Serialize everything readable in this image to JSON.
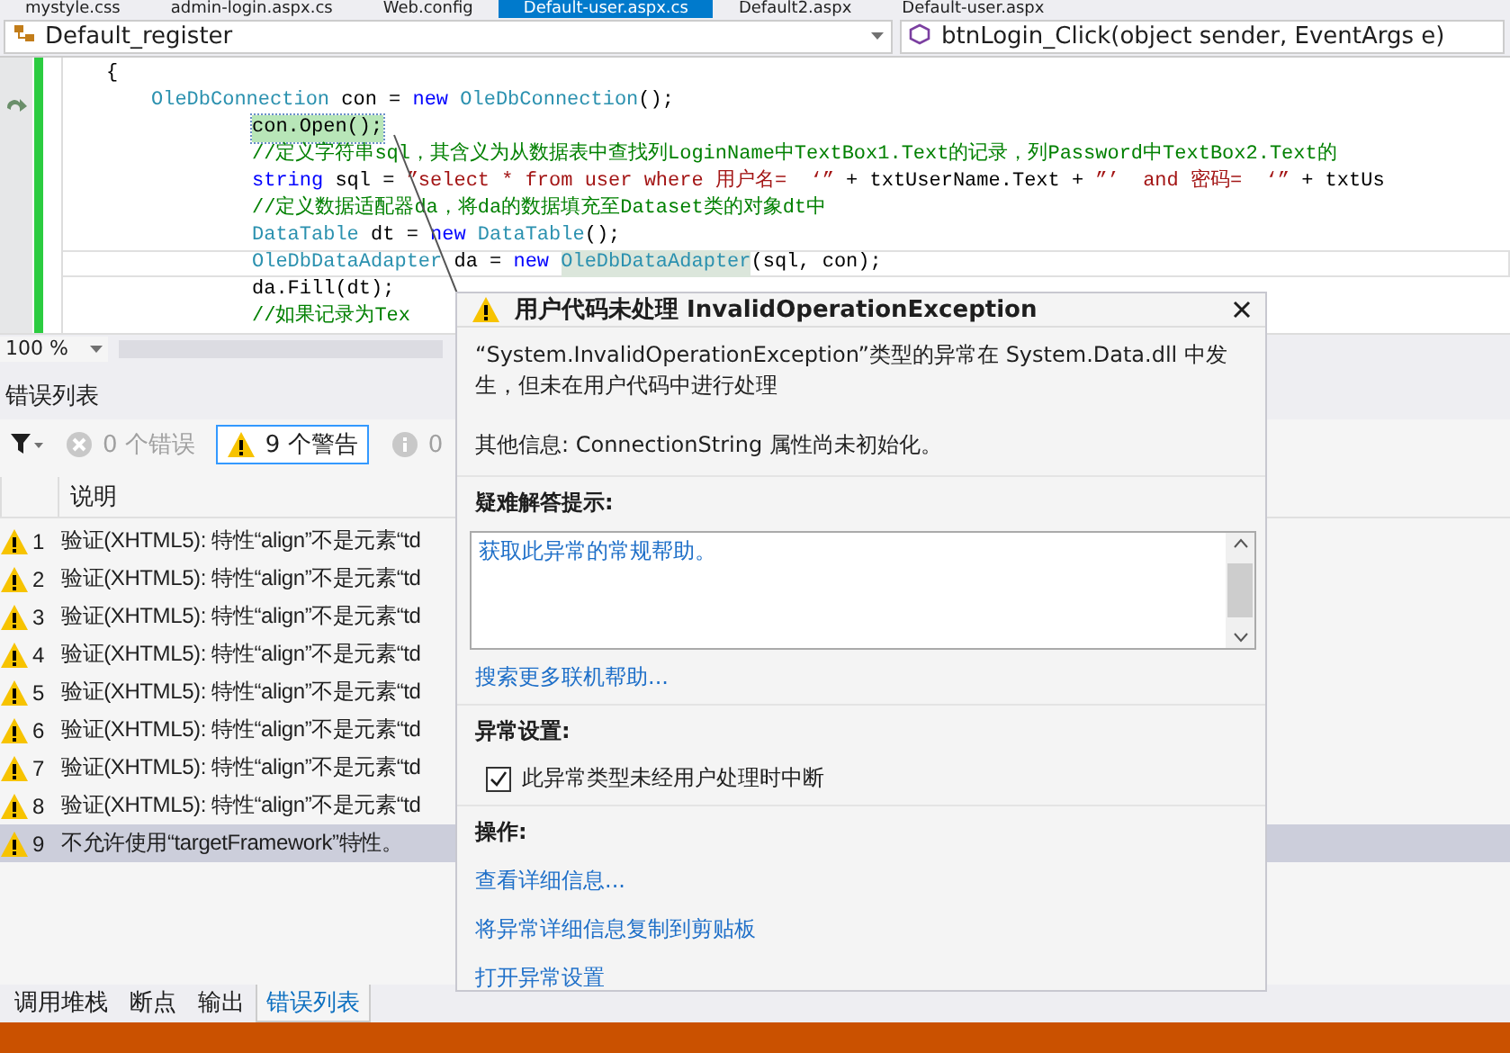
{
  "doc_tabs": [
    {
      "label": "mystyle.css",
      "selected": false
    },
    {
      "label": "admin-login.aspx.cs",
      "selected": false
    },
    {
      "label": "Web.config",
      "selected": false
    },
    {
      "label": "Default-user.aspx.cs",
      "selected": true
    },
    {
      "label": "Default2.aspx",
      "selected": false
    },
    {
      "label": "Default-user.aspx",
      "selected": false
    }
  ],
  "nav_bar": {
    "class_dropdown": "Default_register",
    "member_dropdown": "btnLogin_Click(object sender, EventArgs e)"
  },
  "code_lines": [
    {
      "current": false,
      "tokens": [
        {
          "kind": "plain",
          "text": "{"
        }
      ],
      "children": [
        {
          "current": false,
          "tokens": [
            {
              "kind": "type",
              "text": "OleDbConnection"
            },
            {
              "kind": "plain",
              "text": "con =",
              "space_before": true
            },
            {
              "kind": "keyword",
              "text": "new",
              "space_before": true
            },
            {
              "kind": "type",
              "text": "OleDbConnection",
              "space_before": true
            },
            {
              "kind": "plain",
              "text": "();"
            }
          ],
          "children": [
            {
              "current": false,
              "tokens": [
                {
                  "kind": "plain",
                  "text": "con.Open();",
                  "highlighted": true,
                  "current_statement": true
                }
              ]
            },
            {
              "current": false,
              "tokens": [
                {
                  "kind": "comment",
                  "text": "//定义字符串sql，其含义为从数据表中查找列LoginName中TextBox1.Text的记录，列Password中TextBox2.Text的"
                }
              ]
            },
            {
              "current": false,
              "tokens": [
                {
                  "kind": "keyword",
                  "text": "string"
                },
                {
                  "kind": "plain",
                  "text": "sql =",
                  "space_before": true
                },
                {
                  "kind": "string",
                  "text": "”select * from user where 用户名=  ‘”",
                  "space_before": true
                },
                {
                  "kind": "plain",
                  "text": "+ txtUserName.Text +",
                  "space_before": true
                },
                {
                  "kind": "string",
                  "text": "”’  and 密码=  ‘”",
                  "space_before": true
                },
                {
                  "kind": "plain",
                  "text": "+ txtUs",
                  "space_before": true
                }
              ]
            },
            {
              "current": false,
              "tokens": [
                {
                  "kind": "comment",
                  "text": "//定义数据适配器da，将da的数据填充至Dataset类的对象dt中"
                }
              ]
            },
            {
              "current": false,
              "tokens": [
                {
                  "kind": "type",
                  "text": "DataTable"
                },
                {
                  "kind": "plain",
                  "text": "dt =",
                  "space_before": true
                },
                {
                  "kind": "keyword",
                  "text": "new",
                  "space_before": true
                },
                {
                  "kind": "type",
                  "text": "DataTable",
                  "space_before": true
                },
                {
                  "kind": "plain",
                  "text": "();"
                }
              ]
            },
            {
              "current": true,
              "tokens": [
                {
                  "kind": "type",
                  "text": "OleDbDataAdapter"
                },
                {
                  "kind": "plain",
                  "text": "da =",
                  "space_before": true
                },
                {
                  "kind": "keyword",
                  "text": "new",
                  "space_before": true
                },
                {
                  "kind": "type",
                  "text": "OleDbDataAdapter",
                  "space_before": true,
                  "highlighted": true,
                  "current_statement": false
                },
                {
                  "kind": "plain",
                  "text": "(sql, con);"
                }
              ]
            },
            {
              "current": false,
              "tokens": [
                {
                  "kind": "plain",
                  "text": "da.Fill(dt);"
                }
              ]
            },
            {
              "current": false,
              "tokens": [
                {
                  "kind": "comment",
                  "text": "//如果记录为Tex"
                }
              ]
            }
          ]
        }
      ]
    }
  ],
  "zoom": "100 %",
  "error_list": {
    "title": "错误列表",
    "filters": [
      {
        "kind": "error",
        "label": "0 个错误",
        "selected": false,
        "disabled": true
      },
      {
        "kind": "warning",
        "label": "9 个警告",
        "selected": true,
        "disabled": false
      },
      {
        "kind": "info",
        "label": "0",
        "selected": false,
        "disabled": true
      }
    ],
    "columns": [
      "说明"
    ],
    "rows": [
      {
        "kind": "warning",
        "number": "1",
        "text": "验证(XHTML5): 特性“align”不是元素“td",
        "selected": false
      },
      {
        "kind": "warning",
        "number": "2",
        "text": "验证(XHTML5): 特性“align”不是元素“td",
        "selected": false
      },
      {
        "kind": "warning",
        "number": "3",
        "text": "验证(XHTML5): 特性“align”不是元素“td",
        "selected": false
      },
      {
        "kind": "warning",
        "number": "4",
        "text": "验证(XHTML5): 特性“align”不是元素“td",
        "selected": false
      },
      {
        "kind": "warning",
        "number": "5",
        "text": "验证(XHTML5): 特性“align”不是元素“td",
        "selected": false
      },
      {
        "kind": "warning",
        "number": "6",
        "text": "验证(XHTML5): 特性“align”不是元素“td",
        "selected": false
      },
      {
        "kind": "warning",
        "number": "7",
        "text": "验证(XHTML5): 特性“align”不是元素“td",
        "selected": false
      },
      {
        "kind": "warning",
        "number": "8",
        "text": "验证(XHTML5): 特性“align”不是元素“td",
        "selected": false
      },
      {
        "kind": "warning",
        "number": "9",
        "text": "不允许使用“targetFramework”特性。",
        "selected": true
      }
    ]
  },
  "bottom_tabs": [
    {
      "label": "调用堆栈",
      "selected": false
    },
    {
      "label": "断点",
      "selected": false
    },
    {
      "label": "输出",
      "selected": false
    },
    {
      "label": "错误列表",
      "selected": true
    }
  ],
  "exception_popup": {
    "title": "用户代码未处理 InvalidOperationException",
    "message": "“System.InvalidOperationException”类型的异常在 System.Data.dll 中发生，但未在用户代码中进行处理",
    "additional_info": "其他信息: ConnectionString 属性尚未初始化。",
    "troubleshooting_heading": "疑难解答提示:",
    "troubleshooting_tips": [
      "获取此异常的常规帮助。"
    ],
    "search_link": "搜索更多联机帮助...",
    "settings_heading": "异常设置:",
    "break_option": {
      "label": "此异常类型未经用户处理时中断",
      "checked": true
    },
    "actions_heading": "操作:",
    "actions": [
      "查看详细信息...",
      "将异常详细信息复制到剪贴板",
      "打开异常设置"
    ]
  }
}
